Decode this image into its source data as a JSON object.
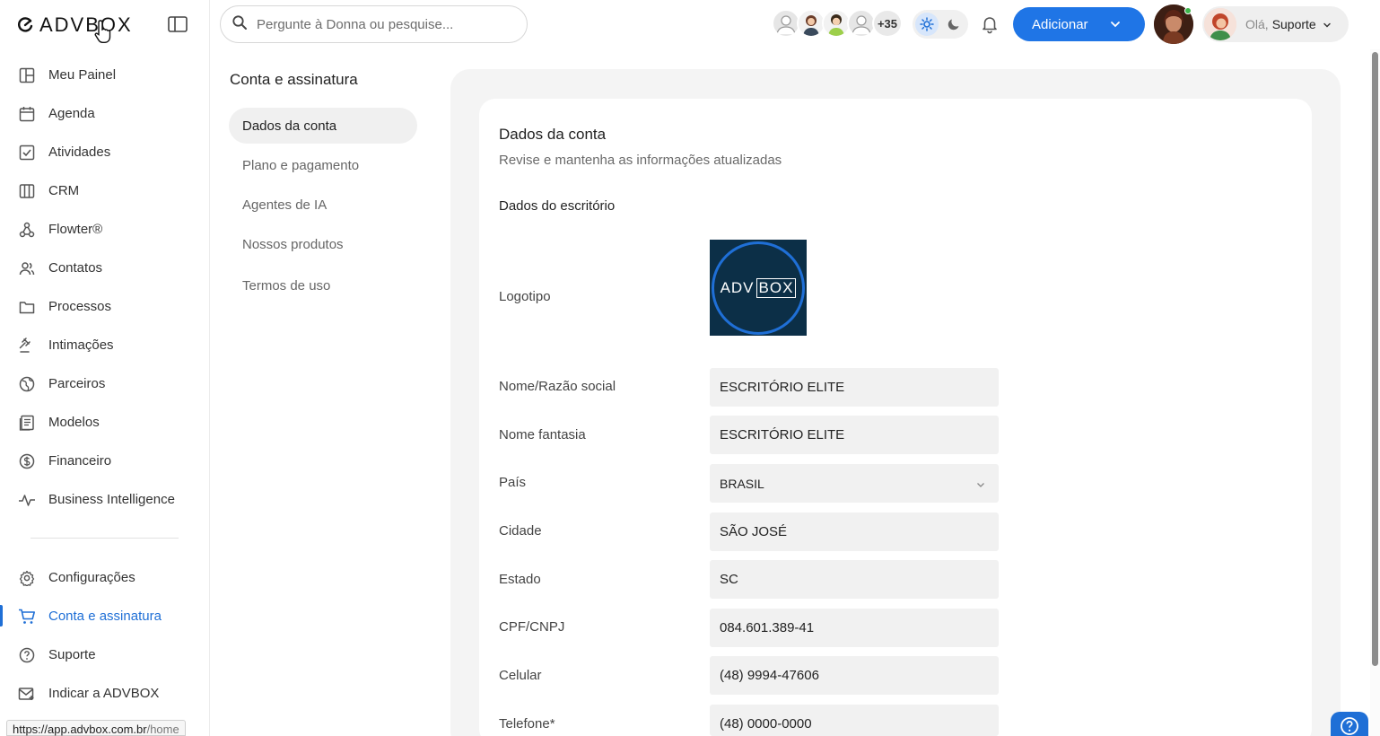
{
  "app": {
    "logo_text": "ADVBOX",
    "status_url_host": "https://app.advbox.com.br",
    "status_url_path": "/home"
  },
  "search": {
    "placeholder": "Pergunte à Donna ou pesquise..."
  },
  "topbar": {
    "avatars_more": "+35",
    "add_label": "Adicionar",
    "greeting": "Olá,",
    "user_name": "Suporte"
  },
  "sidebar": {
    "items": [
      {
        "label": "Meu Painel",
        "icon": "dashboard-icon"
      },
      {
        "label": "Agenda",
        "icon": "calendar-icon"
      },
      {
        "label": "Atividades",
        "icon": "checkbox-icon"
      },
      {
        "label": "CRM",
        "icon": "crm-icon"
      },
      {
        "label": "Flowter®",
        "icon": "flow-icon"
      },
      {
        "label": "Contatos",
        "icon": "contacts-icon"
      },
      {
        "label": "Processos",
        "icon": "folder-icon"
      },
      {
        "label": "Intimações",
        "icon": "gavel-icon"
      },
      {
        "label": "Parceiros",
        "icon": "globe-icon"
      },
      {
        "label": "Modelos",
        "icon": "document-icon"
      },
      {
        "label": "Financeiro",
        "icon": "dollar-icon"
      },
      {
        "label": "Business Intelligence",
        "icon": "pulse-icon"
      }
    ],
    "bottom_items": [
      {
        "label": "Configurações",
        "icon": "gear-icon"
      },
      {
        "label": "Conta e assinatura",
        "icon": "cart-icon",
        "active": true
      },
      {
        "label": "Suporte",
        "icon": "help-icon"
      },
      {
        "label": "Indicar a ADVBOX",
        "icon": "mail-icon"
      }
    ],
    "accent_color": "#1f6fd6"
  },
  "subnav": {
    "title": "Conta e assinatura",
    "items": [
      {
        "label": "Dados da conta",
        "active": true
      },
      {
        "label": "Plano e pagamento"
      },
      {
        "label": "Agentes de IA"
      },
      {
        "label": "Nossos produtos"
      },
      {
        "label": "Termos de uso"
      }
    ]
  },
  "account": {
    "title": "Dados da conta",
    "subtitle": "Revise e mantenha as informações atualizadas",
    "section_title": "Dados do escritório",
    "logo_label": "Logotipo",
    "logo_text_a": "ADV",
    "logo_text_b": "BOX",
    "fields": [
      {
        "label": "Nome/Razão social",
        "value": "ESCRITÓRIO ELITE"
      },
      {
        "label": "Nome fantasia",
        "value": "ESCRITÓRIO ELITE"
      },
      {
        "label": "País",
        "value": "BRASIL",
        "type": "select"
      },
      {
        "label": "Cidade",
        "value": "SÃO JOSÉ"
      },
      {
        "label": "Estado",
        "value": "SC"
      },
      {
        "label": "CPF/CNPJ",
        "value": "084.601.389-41"
      },
      {
        "label": "Celular",
        "value": "(48) 9994-47606"
      },
      {
        "label": "Telefone*",
        "value": "(48) 0000-0000"
      }
    ]
  },
  "colors": {
    "primary": "#1f75e6",
    "logo_bg": "#0c2f47"
  }
}
